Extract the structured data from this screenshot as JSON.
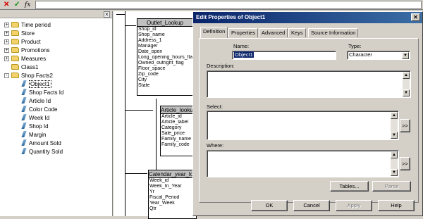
{
  "formula_bar": {
    "cancel_icon": "x-icon",
    "accept_icon": "checkmark-icon",
    "function_label": "fx",
    "value": ""
  },
  "tree": {
    "nodes": [
      {
        "label": "Time period",
        "expander": "+",
        "icon": "folder"
      },
      {
        "label": "Store",
        "expander": "+",
        "icon": "folder"
      },
      {
        "label": "Product",
        "expander": "+",
        "icon": "folder"
      },
      {
        "label": "Promotions",
        "expander": "+",
        "icon": "folder"
      },
      {
        "label": "Measures",
        "expander": "+",
        "icon": "folder"
      },
      {
        "label": "Class1",
        "expander": "",
        "icon": "folder"
      },
      {
        "label": "Shop Facts2",
        "expander": "-",
        "icon": "folder"
      },
      {
        "label": "Object1",
        "expander": "",
        "icon": "object",
        "selected": true
      },
      {
        "label": "Shop Facts Id",
        "expander": "",
        "icon": "object"
      },
      {
        "label": "Article Id",
        "expander": "",
        "icon": "object"
      },
      {
        "label": "Color Code",
        "expander": "",
        "icon": "object"
      },
      {
        "label": "Week Id",
        "expander": "",
        "icon": "object"
      },
      {
        "label": "Shop Id",
        "expander": "",
        "icon": "object"
      },
      {
        "label": "Margin",
        "expander": "",
        "icon": "object"
      },
      {
        "label": "Amount Sold",
        "expander": "",
        "icon": "object"
      },
      {
        "label": "Quantity Sold",
        "expander": "",
        "icon": "object"
      }
    ]
  },
  "canvas": {
    "outlet": {
      "title": "Outlet_Lookup",
      "columns": [
        "Shop_id",
        "Shop_name",
        "Address_1",
        "Manager",
        "Date_open",
        "Long_opening_hours_flag",
        "Owned_outright_flag",
        "Floor_space",
        "Zip_code",
        "City",
        "State"
      ]
    },
    "article": {
      "title": "Article_lookup",
      "columns": [
        "Article_id",
        "Article_label",
        "Category",
        "Sale_price",
        "Family_name",
        "Family_code"
      ]
    },
    "calendar": {
      "title": "Calendar_year_lookup",
      "columns": [
        "Week_id",
        "Week_In_Year",
        "Yr",
        "Fiscal_Period",
        "Year_Week",
        "Qtr"
      ]
    }
  },
  "dialog": {
    "title": "Edit Properties of Object1",
    "tabs": [
      "Definition",
      "Properties",
      "Advanced",
      "Keys",
      "Source Information"
    ],
    "active_tab": "Definition",
    "name_label": "Name:",
    "name_value": "Object1",
    "type_label": "Type:",
    "type_value": "Character",
    "description_label": "Description:",
    "select_label": "Select:",
    "where_label": "Where:",
    "expand_label": ">>",
    "tables_button": "Tables...",
    "parse_button": "Parse",
    "ok_button": "OK",
    "cancel_button": "Cancel",
    "apply_button": "Apply",
    "help_button": "Help",
    "colors": {
      "title_start": "#0a246a",
      "title_end": "#3a6ea5",
      "selection": "#0a246a"
    }
  }
}
